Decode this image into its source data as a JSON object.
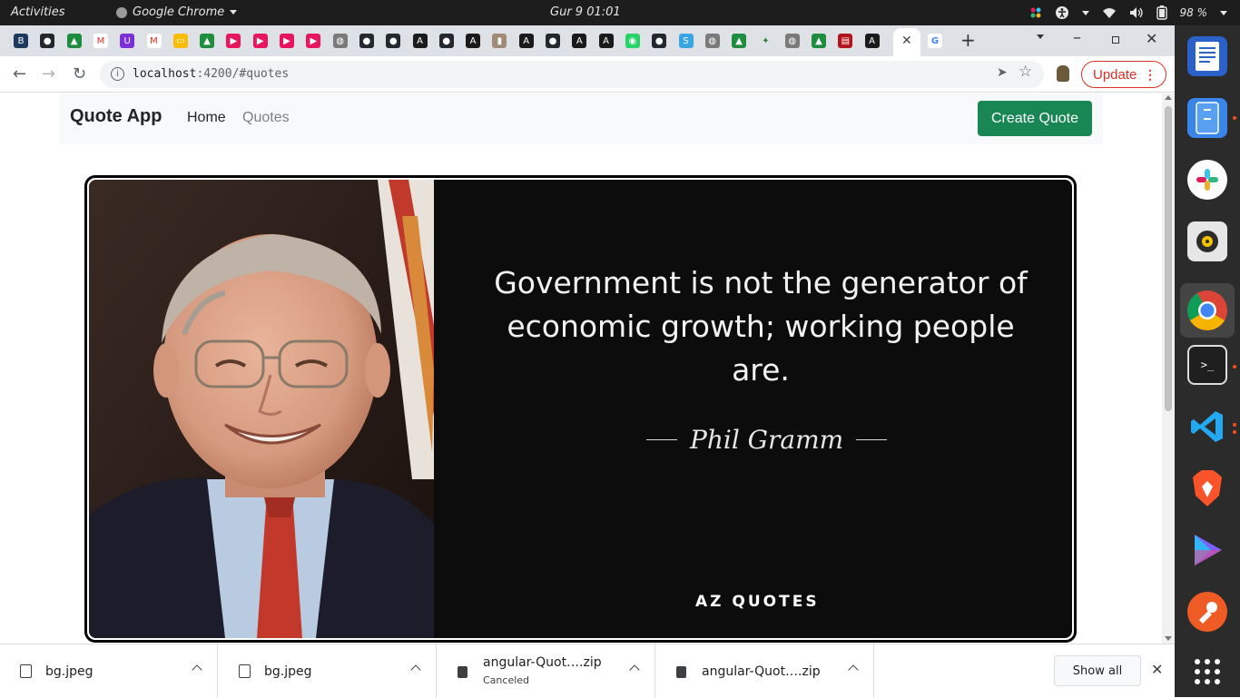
{
  "system_bar": {
    "activities": "Activities",
    "app_name": "Google Chrome",
    "clock": "Gur 9 01:01",
    "battery": "98 %"
  },
  "browser": {
    "url_host": "localhost",
    "url_path": ":4200/#quotes",
    "update_label": "Update",
    "tab_favicons": [
      "b-icon",
      "github-icon",
      "drive-icon",
      "gmail-icon",
      "u-icon",
      "gmail-icon",
      "keep-icon",
      "drive-icon",
      "youtube-icon",
      "youtube-icon",
      "youtube-icon",
      "youtube-icon",
      "globe-icon",
      "github-icon",
      "github-icon",
      "angular-icon",
      "github-icon",
      "angular-icon",
      "image-icon",
      "angular-icon",
      "github-icon",
      "angular-icon",
      "angular-icon",
      "whatsapp-icon",
      "github-icon",
      "s-icon",
      "globe-icon",
      "drive-icon",
      "tree-icon",
      "globe-icon",
      "drive-icon",
      "pdf-icon",
      "angular-icon",
      "google-icon"
    ]
  },
  "navbar": {
    "brand": "Quote App",
    "home": "Home",
    "quotes": "Quotes",
    "create_button": "Create Quote"
  },
  "quote": {
    "text": "Government is not the generator of economic growth; working people are.",
    "author": "Phil Gramm",
    "source_logo": "AZ QUOTES"
  },
  "downloads": [
    {
      "name": "bg.jpeg",
      "status": ""
    },
    {
      "name": "bg.jpeg",
      "status": ""
    },
    {
      "name": "angular-Quot….zip",
      "status": "Canceled"
    },
    {
      "name": "angular-Quot….zip",
      "status": ""
    }
  ],
  "shelf": {
    "show_all": "Show all"
  },
  "colors": {
    "primary_button": "#198754",
    "navbar_bg": "#f8f9fa",
    "update_red": "#d93025",
    "quote_bg": "#0c0c0c"
  }
}
